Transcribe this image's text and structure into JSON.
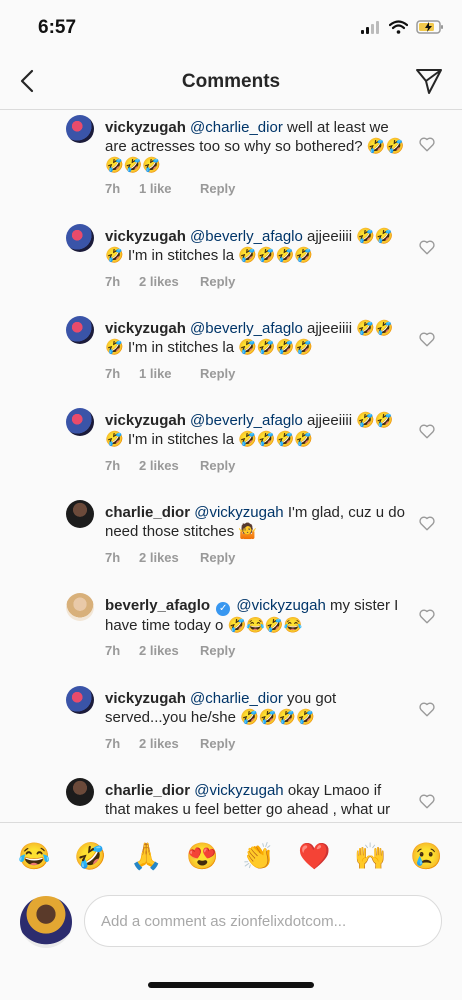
{
  "status_bar": {
    "time": "6:57"
  },
  "nav": {
    "title": "Comments"
  },
  "comments": [
    {
      "user": "vickyzugah",
      "mention": "@charlie_dior",
      "text": " well at least we are actresses too so why so bothered? 🤣🤣🤣🤣🤣",
      "time": "7h",
      "likes": "1 like",
      "reply": "Reply",
      "avatar": "vicky"
    },
    {
      "user": "vickyzugah",
      "mention": "@beverly_afaglo",
      "text": " ajjeeiiii 🤣🤣🤣 I'm in stitches la 🤣🤣🤣🤣",
      "time": "7h",
      "likes": "2 likes",
      "reply": "Reply",
      "avatar": "vicky"
    },
    {
      "user": "vickyzugah",
      "mention": "@beverly_afaglo",
      "text": " ajjeeiiii 🤣🤣🤣 I'm in stitches la 🤣🤣🤣🤣",
      "time": "7h",
      "likes": "1 like",
      "reply": "Reply",
      "avatar": "vicky"
    },
    {
      "user": "vickyzugah",
      "mention": "@beverly_afaglo",
      "text": " ajjeeiiii 🤣🤣🤣 I'm in stitches la 🤣🤣🤣🤣",
      "time": "7h",
      "likes": "2 likes",
      "reply": "Reply",
      "avatar": "vicky"
    },
    {
      "user": "charlie_dior",
      "mention": "@vickyzugah",
      "text": " I'm glad, cuz u do need those stitches 🤷",
      "time": "7h",
      "likes": "2 likes",
      "reply": "Reply",
      "avatar": "charlie"
    },
    {
      "user": "beverly_afaglo",
      "mention": "@vickyzugah",
      "text": " my sister I have time today o 🤣😂🤣😂",
      "time": "7h",
      "likes": "2 likes",
      "reply": "Reply",
      "avatar": "beverly",
      "verified": true
    },
    {
      "user": "vickyzugah",
      "mention": "@charlie_dior",
      "text": " you got served...you he/she 🤣🤣🤣🤣",
      "time": "7h",
      "likes": "2 likes",
      "reply": "Reply",
      "avatar": "vicky"
    },
    {
      "user": "charlie_dior",
      "mention": "@vickyzugah",
      "text": " okay Lmaoo if that makes u feel better go ahead , what ur next project sis? We are all waiting...or",
      "time": "",
      "likes": "",
      "reply": "",
      "avatar": "charlie"
    }
  ],
  "emoji_bar": [
    "😂",
    "🤣",
    "🙏",
    "😍",
    "👏",
    "❤️",
    "🙌",
    "😢"
  ],
  "composer": {
    "placeholder": "Add a comment as zionfelixdotcom..."
  },
  "colors": {
    "mention": "#003569",
    "meta": "#999999",
    "verified": "#3897f0"
  }
}
